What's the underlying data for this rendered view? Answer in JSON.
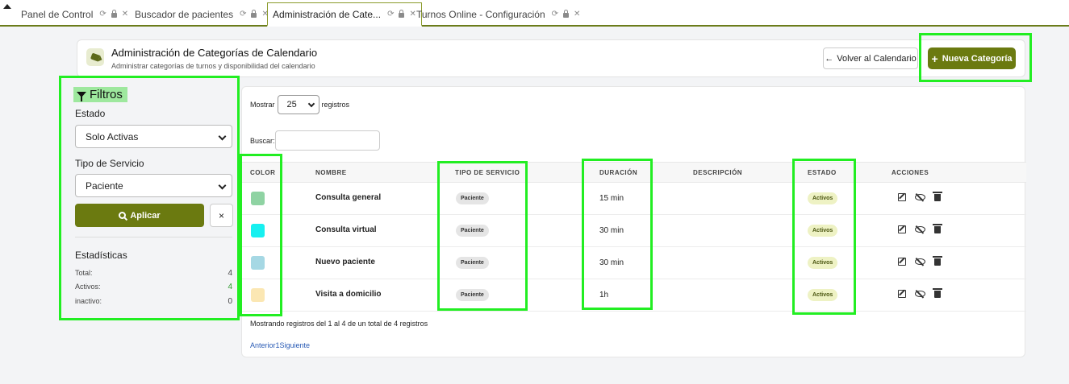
{
  "tabs": [
    {
      "label": "Panel de Control",
      "active": false
    },
    {
      "label": "Buscador de pacientes",
      "active": false
    },
    {
      "label": "Administración de Cate...",
      "active": true
    },
    {
      "label": "Turnos Online - Configuración",
      "active": false
    }
  ],
  "header": {
    "title": "Administración de Categorías de Calendario",
    "subtitle": "Administrar categorías de turnos y disponibilidad del calendario",
    "back_label": "Volver al Calendario",
    "new_label": "Nueva Categoría"
  },
  "filters": {
    "title": "Filtros",
    "estado_label": "Estado",
    "estado_value": "Solo Activas",
    "tipo_label": "Tipo de Servicio",
    "tipo_value": "Paciente",
    "apply_label": "Aplicar",
    "clear_label": "×",
    "stats_title": "Estadísticas",
    "stats": [
      {
        "label": "Total:",
        "value": "4"
      },
      {
        "label": "Activos:",
        "value": "4"
      },
      {
        "label": "inactivo:",
        "value": "0"
      }
    ]
  },
  "table": {
    "show_label": "Mostrar",
    "page_size": "25",
    "records_label": "registros",
    "search_label": "Buscar:",
    "columns": [
      "COLOR",
      "NOMBRE",
      "TIPO DE SERVICIO",
      "DURACIÓN",
      "DESCRIPCIÓN",
      "ESTADO",
      "ACCIONES"
    ],
    "rows": [
      {
        "color": "#8fd3a3",
        "name": "Consulta general",
        "type": "Paciente",
        "duration": "15 min",
        "description": "",
        "status": "Activos"
      },
      {
        "color": "#17f0f0",
        "name": "Consulta virtual",
        "type": "Paciente",
        "duration": "30 min",
        "description": "",
        "status": "Activos"
      },
      {
        "color": "#a6d8e4",
        "name": "Nuevo paciente",
        "type": "Paciente",
        "duration": "30 min",
        "description": "",
        "status": "Activos"
      },
      {
        "color": "#fbe7b3",
        "name": "Visita a domicilio",
        "type": "Paciente",
        "duration": "1h",
        "description": "",
        "status": "Activos"
      }
    ],
    "info": "Mostrando registros del 1 al 4 de un total de 4 registros",
    "pager": {
      "prev": "Anterior",
      "page": "1",
      "next": "Siguiente"
    }
  }
}
